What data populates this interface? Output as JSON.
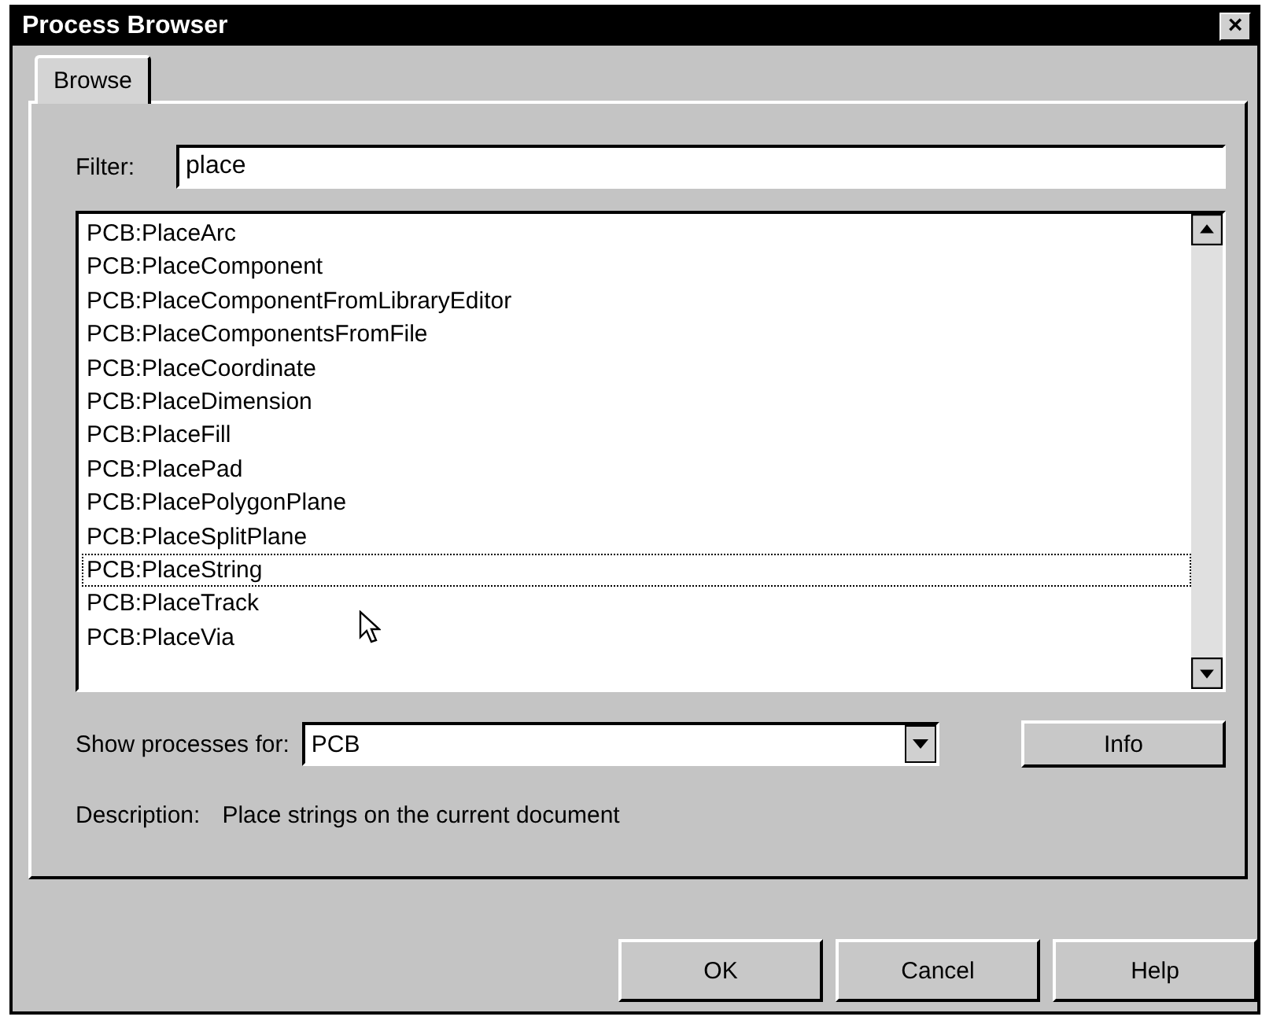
{
  "window": {
    "title": "Process Browser",
    "close": "×"
  },
  "tabs": [
    {
      "label": "Browse",
      "selected": true
    }
  ],
  "filter": {
    "label": "Filter:",
    "value": "place"
  },
  "processes": [
    {
      "name": "PCB:PlaceArc",
      "focused": false
    },
    {
      "name": "PCB:PlaceComponent",
      "focused": false
    },
    {
      "name": "PCB:PlaceComponentFromLibraryEditor",
      "focused": false
    },
    {
      "name": "PCB:PlaceComponentsFromFile",
      "focused": false
    },
    {
      "name": "PCB:PlaceCoordinate",
      "focused": false
    },
    {
      "name": "PCB:PlaceDimension",
      "focused": false
    },
    {
      "name": "PCB:PlaceFill",
      "focused": false
    },
    {
      "name": "PCB:PlacePad",
      "focused": false
    },
    {
      "name": "PCB:PlacePolygonPlane",
      "focused": false
    },
    {
      "name": "PCB:PlaceSplitPlane",
      "focused": false
    },
    {
      "name": "PCB:PlaceString",
      "focused": true
    },
    {
      "name": "PCB:PlaceTrack",
      "focused": false
    },
    {
      "name": "PCB:PlaceVia",
      "focused": false
    }
  ],
  "show_processes": {
    "label": "Show processes for:",
    "value": "PCB"
  },
  "info_button": "Info",
  "description": {
    "label": "Description:",
    "text": "Place strings on the current document"
  },
  "buttons": [
    "OK",
    "Cancel",
    "Help"
  ]
}
